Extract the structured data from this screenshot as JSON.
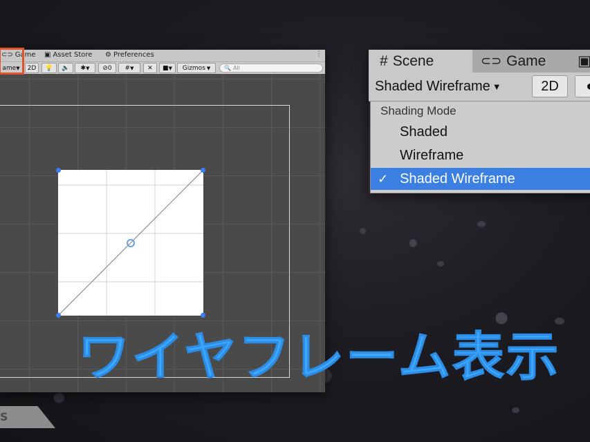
{
  "scene_window": {
    "tabs": [
      {
        "label": "Game",
        "icon": "gamepad-icon"
      },
      {
        "label": "Asset Store",
        "icon": "shopping-bag-icon"
      },
      {
        "label": "Preferences",
        "icon": "gear-icon"
      }
    ],
    "toolbar": {
      "draw_mode_label": "ame",
      "mode_2d_label": "2D",
      "hidden_objects_count": "0",
      "gizmos_label": "Gizmos",
      "search_placeholder": "All"
    }
  },
  "zoom_window": {
    "tabs": [
      {
        "label": "Scene",
        "icon": "hash-icon"
      },
      {
        "label": "Game",
        "icon": "gamepad-icon"
      }
    ],
    "toolbar": {
      "draw_mode_label": "Shaded Wireframe",
      "mode_2d_label": "2D"
    },
    "menu": {
      "header": "Shading Mode",
      "items": [
        {
          "label": "Shaded",
          "selected": false
        },
        {
          "label": "Wireframe",
          "selected": false
        },
        {
          "label": "Shaded Wireframe",
          "selected": true
        }
      ],
      "check_mark": "✓"
    }
  },
  "caption": "ワイヤフレーム表示",
  "corner_tag_text": "S",
  "colors": {
    "accent_highlight": "#e0542a",
    "selection_blue": "#3a7fe1",
    "caption_blue": "#3ea8ff"
  }
}
